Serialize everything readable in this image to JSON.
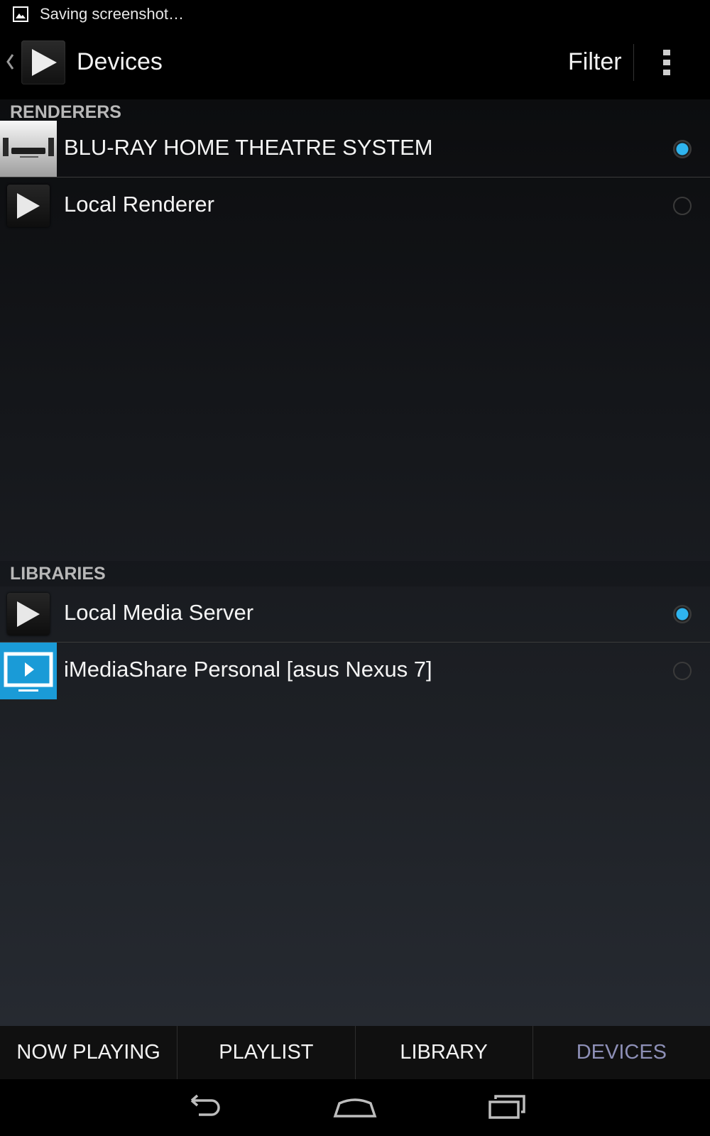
{
  "status_bar": {
    "notification_text": "Saving screenshot…"
  },
  "action_bar": {
    "title": "Devices",
    "filter_label": "Filter"
  },
  "renderers": {
    "header": "RENDERERS",
    "items": [
      {
        "label": "BLU-RAY HOME THEATRE SYSTEM",
        "selected": true
      },
      {
        "label": "Local Renderer",
        "selected": false
      }
    ]
  },
  "libraries": {
    "header": "LIBRARIES",
    "items": [
      {
        "label": "Local Media Server",
        "selected": true
      },
      {
        "label": "iMediaShare Personal [asus Nexus 7]",
        "selected": false
      }
    ]
  },
  "tabs": [
    {
      "label": "NOW PLAYING",
      "active": false
    },
    {
      "label": "PLAYLIST",
      "active": false
    },
    {
      "label": "LIBRARY",
      "active": false
    },
    {
      "label": "DEVICES",
      "active": true
    }
  ],
  "colors": {
    "accent_radio": "#2fb4ee",
    "active_tab": "#8d8fb6",
    "imediashare_blue": "#1a9bd7"
  }
}
